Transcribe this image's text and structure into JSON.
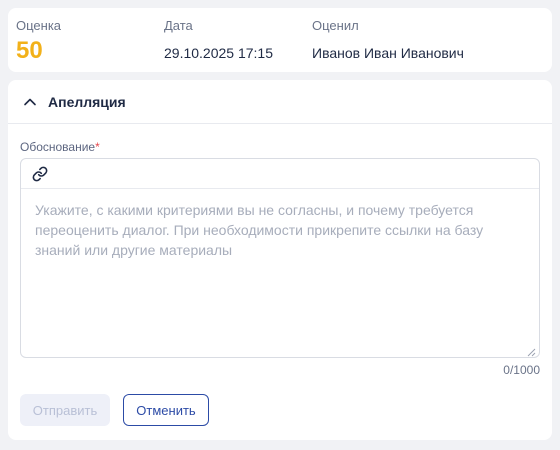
{
  "summary": {
    "score_label": "Оценка",
    "score_value": "50",
    "date_label": "Дата",
    "date_value": "29.10.2025 17:15",
    "rater_label": "Оценил",
    "rater_value": "Иванов Иван Иванович"
  },
  "appeal": {
    "title": "Апелляция",
    "expanded": true,
    "field_label": "Обоснование",
    "required_mark": "*",
    "text_value": "",
    "placeholder": "Укажите, с какими критериями вы не согласны, и почему требуется переоценить диалог. При необходимости прикрепите ссылки на базу знаний или другие материалы",
    "counter": "0/1000",
    "toolbar_icon": "link-icon",
    "send_label": "Отправить",
    "send_disabled": true,
    "cancel_label": "Отменить"
  },
  "colors": {
    "score": "#f2b11a",
    "accent": "#2c4ba6",
    "required": "#e5484d",
    "background": "#f1f2f5"
  }
}
